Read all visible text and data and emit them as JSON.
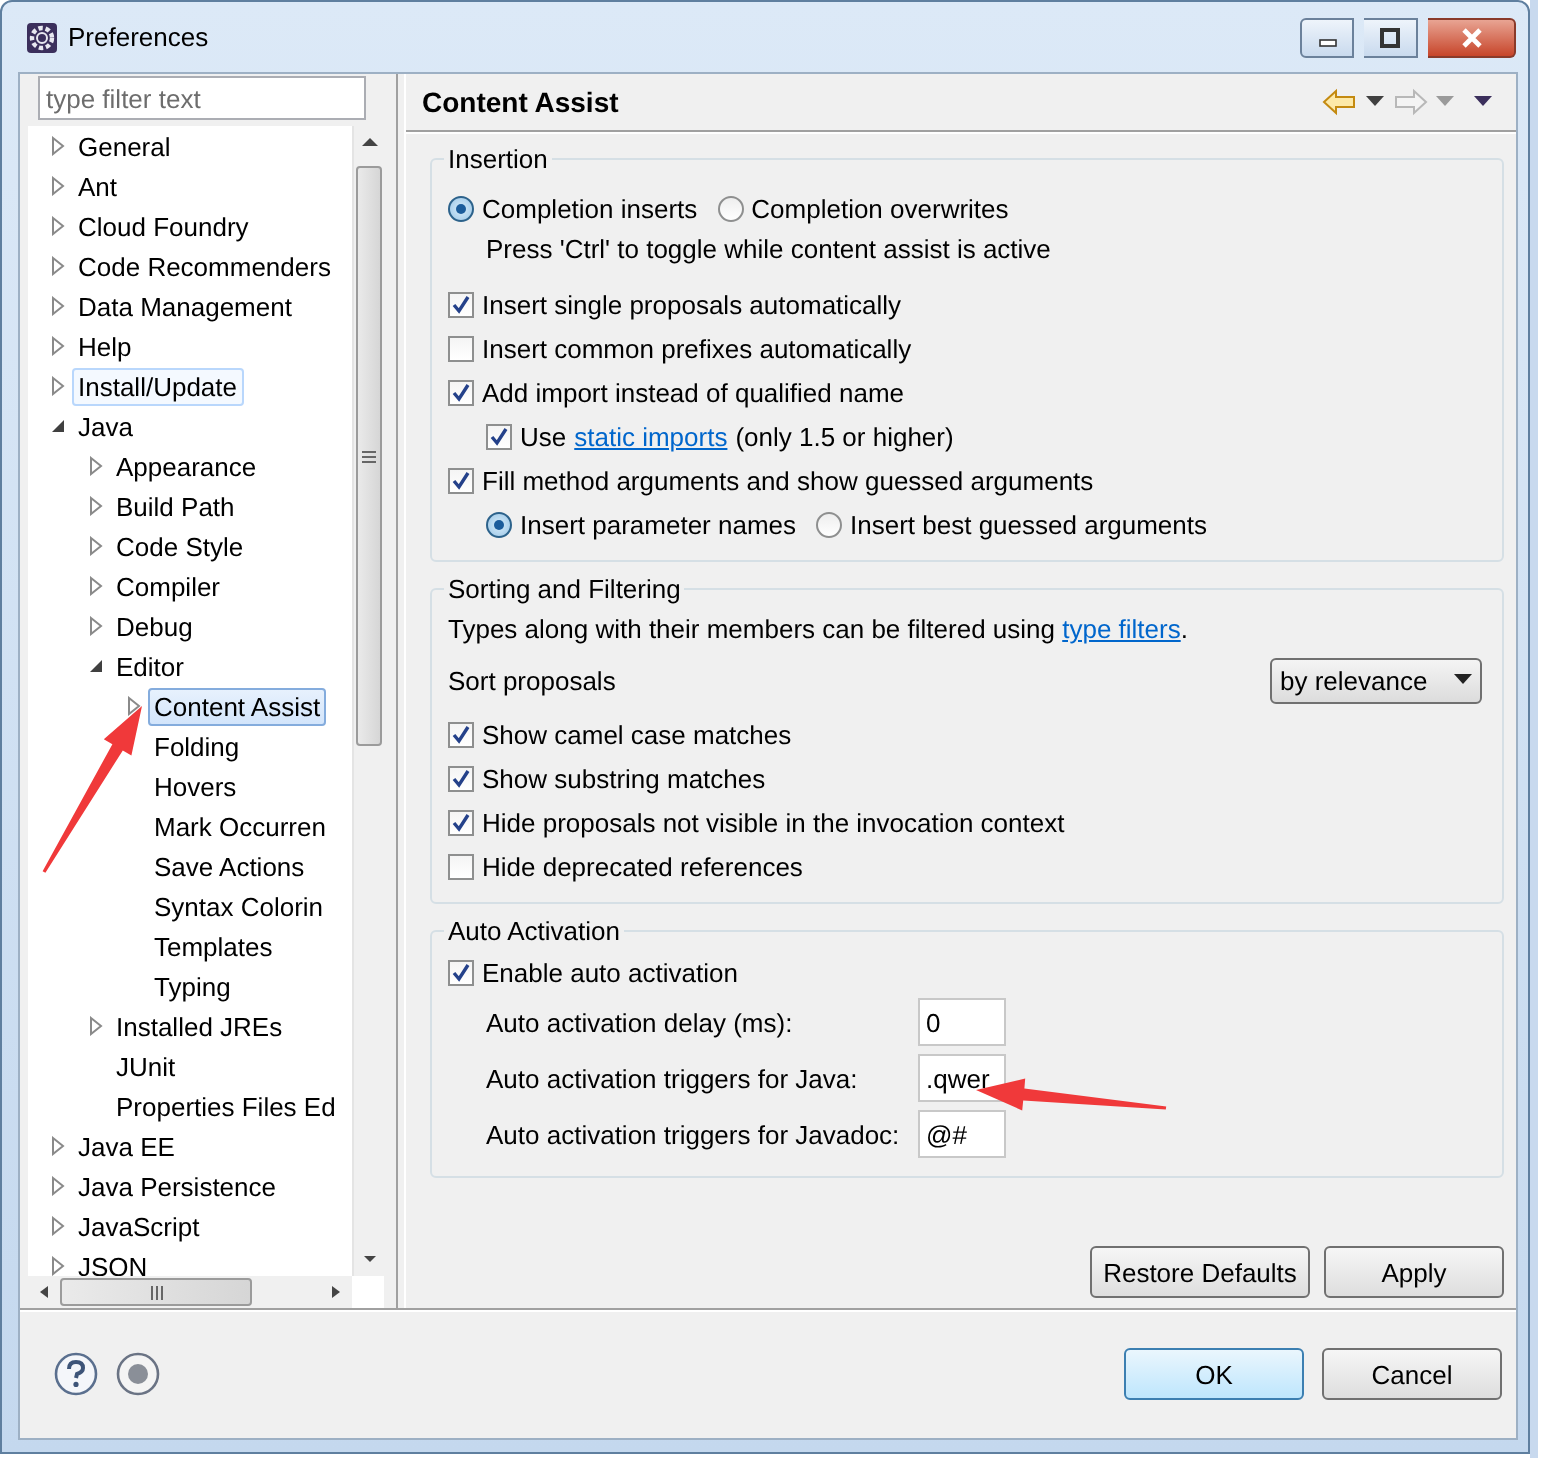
{
  "window": {
    "title": "Preferences"
  },
  "filter": {
    "placeholder": "type filter text"
  },
  "tree": [
    {
      "label": "General",
      "expanded": false,
      "selected": false,
      "hovered": false
    },
    {
      "label": "Ant",
      "expanded": false,
      "selected": false,
      "hovered": false
    },
    {
      "label": "Cloud Foundry",
      "expanded": false,
      "selected": false,
      "hovered": false
    },
    {
      "label": "Code Recommenders",
      "expanded": false,
      "selected": false,
      "hovered": false
    },
    {
      "label": "Data Management",
      "expanded": false,
      "selected": false,
      "hovered": false
    },
    {
      "label": "Help",
      "expanded": false,
      "selected": false,
      "hovered": false
    },
    {
      "label": "Install/Update",
      "expanded": false,
      "selected": false,
      "hovered": true
    },
    {
      "label": "Java",
      "expanded": true,
      "selected": false,
      "hovered": false,
      "children": [
        {
          "label": "Appearance",
          "expanded": false,
          "selected": false,
          "hovered": false
        },
        {
          "label": "Build Path",
          "expanded": false,
          "selected": false,
          "hovered": false
        },
        {
          "label": "Code Style",
          "expanded": false,
          "selected": false,
          "hovered": false
        },
        {
          "label": "Compiler",
          "expanded": false,
          "selected": false,
          "hovered": false
        },
        {
          "label": "Debug",
          "expanded": false,
          "selected": false,
          "hovered": false
        },
        {
          "label": "Editor",
          "expanded": true,
          "selected": false,
          "hovered": false,
          "children": [
            {
              "label": "Content Assist",
              "expanded": false,
              "selected": true,
              "hovered": false
            },
            {
              "label": "Folding",
              "selected": false,
              "hovered": false
            },
            {
              "label": "Hovers",
              "selected": false,
              "hovered": false
            },
            {
              "label": "Mark Occurren",
              "selected": false,
              "hovered": false
            },
            {
              "label": "Save Actions",
              "selected": false,
              "hovered": false
            },
            {
              "label": "Syntax Colorin",
              "selected": false,
              "hovered": false
            },
            {
              "label": "Templates",
              "selected": false,
              "hovered": false
            },
            {
              "label": "Typing",
              "selected": false,
              "hovered": false
            }
          ]
        },
        {
          "label": "Installed JREs",
          "expanded": false,
          "selected": false,
          "hovered": false
        },
        {
          "label": "JUnit",
          "selected": false,
          "hovered": false
        },
        {
          "label": "Properties Files Ed",
          "selected": false,
          "hovered": false
        }
      ]
    },
    {
      "label": "Java EE",
      "expanded": false,
      "selected": false,
      "hovered": false
    },
    {
      "label": "Java Persistence",
      "expanded": false,
      "selected": false,
      "hovered": false
    },
    {
      "label": "JavaScript",
      "expanded": false,
      "selected": false,
      "hovered": false
    },
    {
      "label": "JSON",
      "expanded": false,
      "selected": false,
      "hovered": false
    }
  ],
  "page": {
    "title": "Content Assist",
    "nav": {
      "back_enabled": true,
      "forward_enabled": false
    }
  },
  "insertion": {
    "title": "Insertion",
    "items": [
      {
        "kind": "radios",
        "options": [
          {
            "label": "Completion inserts",
            "selected": true
          },
          {
            "label": "Completion overwrites",
            "selected": false
          }
        ]
      },
      {
        "kind": "note",
        "text": "Press 'Ctrl' to toggle while content assist is active"
      },
      {
        "kind": "check",
        "label": "Insert single proposals automatically",
        "checked": true
      },
      {
        "kind": "check",
        "label": "Insert common prefixes automatically",
        "checked": false
      },
      {
        "kind": "check",
        "label": "Add import instead of qualified name",
        "checked": true,
        "children": [
          {
            "kind": "linkcheck",
            "before": "Use",
            "link": "static imports",
            "after": "(only 1.5 or higher)",
            "checked": true
          }
        ]
      },
      {
        "kind": "check",
        "label": "Fill method arguments and show guessed arguments",
        "checked": true,
        "children": [
          {
            "kind": "radios",
            "options": [
              {
                "label": "Insert parameter names",
                "selected": true
              },
              {
                "label": "Insert best guessed arguments",
                "selected": false
              }
            ]
          }
        ]
      }
    ]
  },
  "sorting": {
    "title": "Sorting and Filtering",
    "note_before": "Types along with their members can be filtered using",
    "note_link": "type filters",
    "note_after": ".",
    "sort_label": "Sort proposals",
    "sort_value": "by relevance",
    "checks": [
      {
        "label": "Show camel case matches",
        "checked": true
      },
      {
        "label": "Show substring matches",
        "checked": true
      },
      {
        "label": "Hide proposals not visible in the invocation context",
        "checked": true
      },
      {
        "label": "Hide deprecated references",
        "checked": false
      }
    ]
  },
  "auto_activation": {
    "title": "Auto Activation",
    "enable": {
      "label": "Enable auto activation",
      "checked": true
    },
    "fields": [
      {
        "label": "Auto activation delay (ms):",
        "value": "0"
      },
      {
        "label": "Auto activation triggers for Java:",
        "value": ".qwer"
      },
      {
        "label": "Auto activation triggers for Javadoc:",
        "value": "@#"
      }
    ]
  },
  "page_buttons": [
    "Restore Defaults",
    "Apply"
  ],
  "footer_buttons": [
    {
      "label": "OK",
      "default": true
    },
    {
      "label": "Cancel",
      "default": false
    }
  ]
}
